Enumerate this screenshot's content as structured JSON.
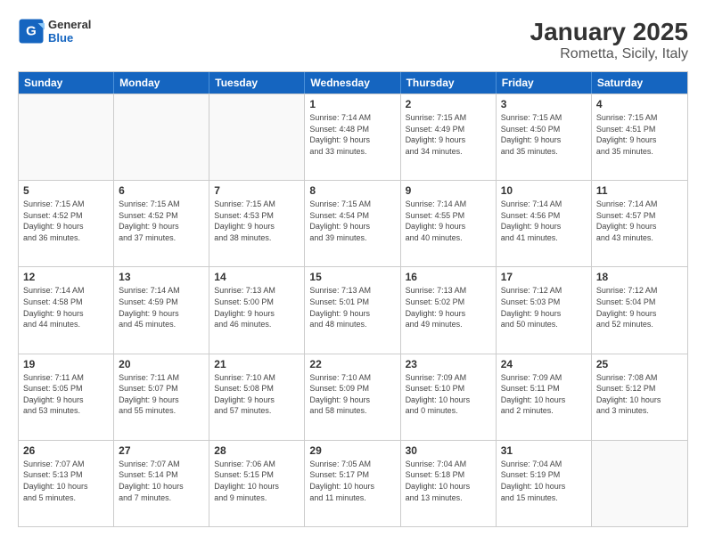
{
  "header": {
    "logo_general": "General",
    "logo_blue": "Blue",
    "title": "January 2025",
    "subtitle": "Rometta, Sicily, Italy"
  },
  "weekdays": [
    "Sunday",
    "Monday",
    "Tuesday",
    "Wednesday",
    "Thursday",
    "Friday",
    "Saturday"
  ],
  "rows": [
    [
      {
        "day": "",
        "info": ""
      },
      {
        "day": "",
        "info": ""
      },
      {
        "day": "",
        "info": ""
      },
      {
        "day": "1",
        "info": "Sunrise: 7:14 AM\nSunset: 4:48 PM\nDaylight: 9 hours\nand 33 minutes."
      },
      {
        "day": "2",
        "info": "Sunrise: 7:15 AM\nSunset: 4:49 PM\nDaylight: 9 hours\nand 34 minutes."
      },
      {
        "day": "3",
        "info": "Sunrise: 7:15 AM\nSunset: 4:50 PM\nDaylight: 9 hours\nand 35 minutes."
      },
      {
        "day": "4",
        "info": "Sunrise: 7:15 AM\nSunset: 4:51 PM\nDaylight: 9 hours\nand 35 minutes."
      }
    ],
    [
      {
        "day": "5",
        "info": "Sunrise: 7:15 AM\nSunset: 4:52 PM\nDaylight: 9 hours\nand 36 minutes."
      },
      {
        "day": "6",
        "info": "Sunrise: 7:15 AM\nSunset: 4:52 PM\nDaylight: 9 hours\nand 37 minutes."
      },
      {
        "day": "7",
        "info": "Sunrise: 7:15 AM\nSunset: 4:53 PM\nDaylight: 9 hours\nand 38 minutes."
      },
      {
        "day": "8",
        "info": "Sunrise: 7:15 AM\nSunset: 4:54 PM\nDaylight: 9 hours\nand 39 minutes."
      },
      {
        "day": "9",
        "info": "Sunrise: 7:14 AM\nSunset: 4:55 PM\nDaylight: 9 hours\nand 40 minutes."
      },
      {
        "day": "10",
        "info": "Sunrise: 7:14 AM\nSunset: 4:56 PM\nDaylight: 9 hours\nand 41 minutes."
      },
      {
        "day": "11",
        "info": "Sunrise: 7:14 AM\nSunset: 4:57 PM\nDaylight: 9 hours\nand 43 minutes."
      }
    ],
    [
      {
        "day": "12",
        "info": "Sunrise: 7:14 AM\nSunset: 4:58 PM\nDaylight: 9 hours\nand 44 minutes."
      },
      {
        "day": "13",
        "info": "Sunrise: 7:14 AM\nSunset: 4:59 PM\nDaylight: 9 hours\nand 45 minutes."
      },
      {
        "day": "14",
        "info": "Sunrise: 7:13 AM\nSunset: 5:00 PM\nDaylight: 9 hours\nand 46 minutes."
      },
      {
        "day": "15",
        "info": "Sunrise: 7:13 AM\nSunset: 5:01 PM\nDaylight: 9 hours\nand 48 minutes."
      },
      {
        "day": "16",
        "info": "Sunrise: 7:13 AM\nSunset: 5:02 PM\nDaylight: 9 hours\nand 49 minutes."
      },
      {
        "day": "17",
        "info": "Sunrise: 7:12 AM\nSunset: 5:03 PM\nDaylight: 9 hours\nand 50 minutes."
      },
      {
        "day": "18",
        "info": "Sunrise: 7:12 AM\nSunset: 5:04 PM\nDaylight: 9 hours\nand 52 minutes."
      }
    ],
    [
      {
        "day": "19",
        "info": "Sunrise: 7:11 AM\nSunset: 5:05 PM\nDaylight: 9 hours\nand 53 minutes."
      },
      {
        "day": "20",
        "info": "Sunrise: 7:11 AM\nSunset: 5:07 PM\nDaylight: 9 hours\nand 55 minutes."
      },
      {
        "day": "21",
        "info": "Sunrise: 7:10 AM\nSunset: 5:08 PM\nDaylight: 9 hours\nand 57 minutes."
      },
      {
        "day": "22",
        "info": "Sunrise: 7:10 AM\nSunset: 5:09 PM\nDaylight: 9 hours\nand 58 minutes."
      },
      {
        "day": "23",
        "info": "Sunrise: 7:09 AM\nSunset: 5:10 PM\nDaylight: 10 hours\nand 0 minutes."
      },
      {
        "day": "24",
        "info": "Sunrise: 7:09 AM\nSunset: 5:11 PM\nDaylight: 10 hours\nand 2 minutes."
      },
      {
        "day": "25",
        "info": "Sunrise: 7:08 AM\nSunset: 5:12 PM\nDaylight: 10 hours\nand 3 minutes."
      }
    ],
    [
      {
        "day": "26",
        "info": "Sunrise: 7:07 AM\nSunset: 5:13 PM\nDaylight: 10 hours\nand 5 minutes."
      },
      {
        "day": "27",
        "info": "Sunrise: 7:07 AM\nSunset: 5:14 PM\nDaylight: 10 hours\nand 7 minutes."
      },
      {
        "day": "28",
        "info": "Sunrise: 7:06 AM\nSunset: 5:15 PM\nDaylight: 10 hours\nand 9 minutes."
      },
      {
        "day": "29",
        "info": "Sunrise: 7:05 AM\nSunset: 5:17 PM\nDaylight: 10 hours\nand 11 minutes."
      },
      {
        "day": "30",
        "info": "Sunrise: 7:04 AM\nSunset: 5:18 PM\nDaylight: 10 hours\nand 13 minutes."
      },
      {
        "day": "31",
        "info": "Sunrise: 7:04 AM\nSunset: 5:19 PM\nDaylight: 10 hours\nand 15 minutes."
      },
      {
        "day": "",
        "info": ""
      }
    ]
  ]
}
